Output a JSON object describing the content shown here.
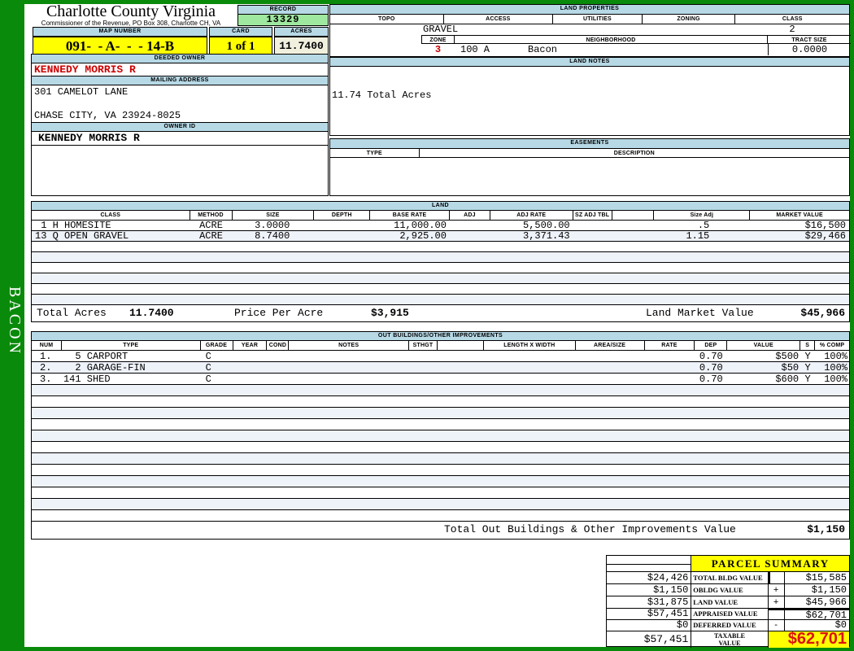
{
  "colors": {
    "frame_green": "#0a8a0a",
    "header_bar_blue": "#b7d9e6",
    "record_green": "#9fe89f",
    "highlight_yellow": "#ffff00",
    "acres_cream": "#f1f0de",
    "alert_red": "#cc0000",
    "row_stripe": "#eef2f9"
  },
  "sidebar": {
    "vertical_label": "BACON"
  },
  "header": {
    "county_title": "Charlotte County Virginia",
    "commissioner_line": "Commissioner of the Revenue, PO Box 308, Charlotte CH, VA",
    "record_label": "RECORD",
    "record_value": "13329",
    "map_number_label": "MAP NUMBER",
    "map_number_value": "091-  - A-  -  - 14-B",
    "card_label": "CARD",
    "card_value": "1 of 1",
    "acres_label": "ACRES",
    "acres_value": "11.7400"
  },
  "owner": {
    "deeded_owner_label": "DEEDED OWNER",
    "deeded_owner": "KENNEDY MORRIS R",
    "mailing_address_label": "MAILING ADDRESS",
    "address_line1": "301 CAMELOT LANE",
    "address_line2": "CHASE CITY, VA 23924-8025",
    "owner_id_label": "OWNER ID",
    "owner_id": "KENNEDY MORRIS R"
  },
  "land_properties": {
    "title": "LAND PROPERTIES",
    "columns": [
      "TOPO",
      "ACCESS",
      "UTILITIES",
      "ZONING",
      "CLASS"
    ],
    "access_value": "GRAVEL",
    "class_value": "2",
    "zone_label": "ZONE",
    "zone_value": "3",
    "neighborhood_label": "NEIGHBORHOOD",
    "neighborhood_code": "100 A",
    "neighborhood_name": "Bacon",
    "tract_size_label": "TRACT SIZE",
    "tract_size_value": "0.0000"
  },
  "land_notes": {
    "title": "LAND NOTES",
    "note": "11.74 Total Acres"
  },
  "easements": {
    "title": "EASEMENTS",
    "columns": [
      "TYPE",
      "DESCRIPTION"
    ]
  },
  "land_table": {
    "title": "LAND",
    "columns": [
      "CLASS",
      "METHOD",
      "SIZE",
      "DEPTH",
      "BASE RATE",
      "ADJ",
      "ADJ RATE",
      "SZ ADJ TBL",
      "",
      "Size Adj",
      "MARKET VALUE"
    ],
    "rows": [
      {
        "class": " 1 H HOMESITE",
        "method": "ACRE",
        "size": "3.0000",
        "base_rate": "11,000.00",
        "adj_rate": "5,500.00",
        "size_adj": ".5",
        "market_value": "$16,500"
      },
      {
        "class": "13 Q OPEN GRAVEL",
        "method": "ACRE",
        "size": "8.7400",
        "base_rate": "2,925.00",
        "adj_rate": "3,371.43",
        "size_adj": "1.15",
        "market_value": "$29,466"
      }
    ],
    "totals": {
      "total_acres_label": "Total Acres",
      "total_acres": "11.7400",
      "price_per_acre_label": "Price Per Acre",
      "price_per_acre": "$3,915",
      "land_market_value_label": "Land Market Value",
      "land_market_value": "$45,966"
    }
  },
  "out_buildings": {
    "title": "OUT BUILDINGS/OTHER IMPROVEMENTS",
    "columns": [
      "NUM",
      "TYPE",
      "GRADE",
      "YEAR",
      "COND",
      "NOTES",
      "STHGT",
      "LENGTH X WIDTH",
      "AREA/SIZE",
      "RATE",
      "DEP",
      "VALUE",
      "S",
      "% COMP"
    ],
    "rows": [
      {
        "num": "1.",
        "type": "  5 CARPORT",
        "grade": "C",
        "dep": "0.70",
        "value": "$500",
        "s": "Y",
        "pct_comp": "100%"
      },
      {
        "num": "2.",
        "type": "  2 GARAGE-FIN",
        "grade": "C",
        "dep": "0.70",
        "value": "$50",
        "s": "Y",
        "pct_comp": "100%"
      },
      {
        "num": "3.",
        "type": "141 SHED",
        "grade": "C",
        "dep": "0.70",
        "value": "$600",
        "s": "Y",
        "pct_comp": "100%"
      }
    ],
    "total_label": "Total Out Buildings & Other Improvements Value",
    "total_value": "$1,150"
  },
  "parcel_summary": {
    "title": "PARCEL SUMMARY",
    "rows": [
      {
        "prior": "$24,426",
        "label": "TOTAL BLDG VALUE",
        "op": "",
        "value": "$15,585"
      },
      {
        "prior": "$1,150",
        "label": "OBLDG VALUE",
        "op": "+",
        "value": "$1,150"
      },
      {
        "prior": "$31,875",
        "label": "LAND VALUE",
        "op": "+",
        "value": "$45,966"
      },
      {
        "prior": "$57,451",
        "label": "APPRAISED VALUE",
        "op": "",
        "value": "$62,701"
      },
      {
        "prior": "$0",
        "label": "DEFERRED VALUE",
        "op": "-",
        "value": "$0"
      }
    ],
    "taxable": {
      "prior": "$57,451",
      "label": "TAXABLE VALUE",
      "value": "$62,701"
    }
  }
}
